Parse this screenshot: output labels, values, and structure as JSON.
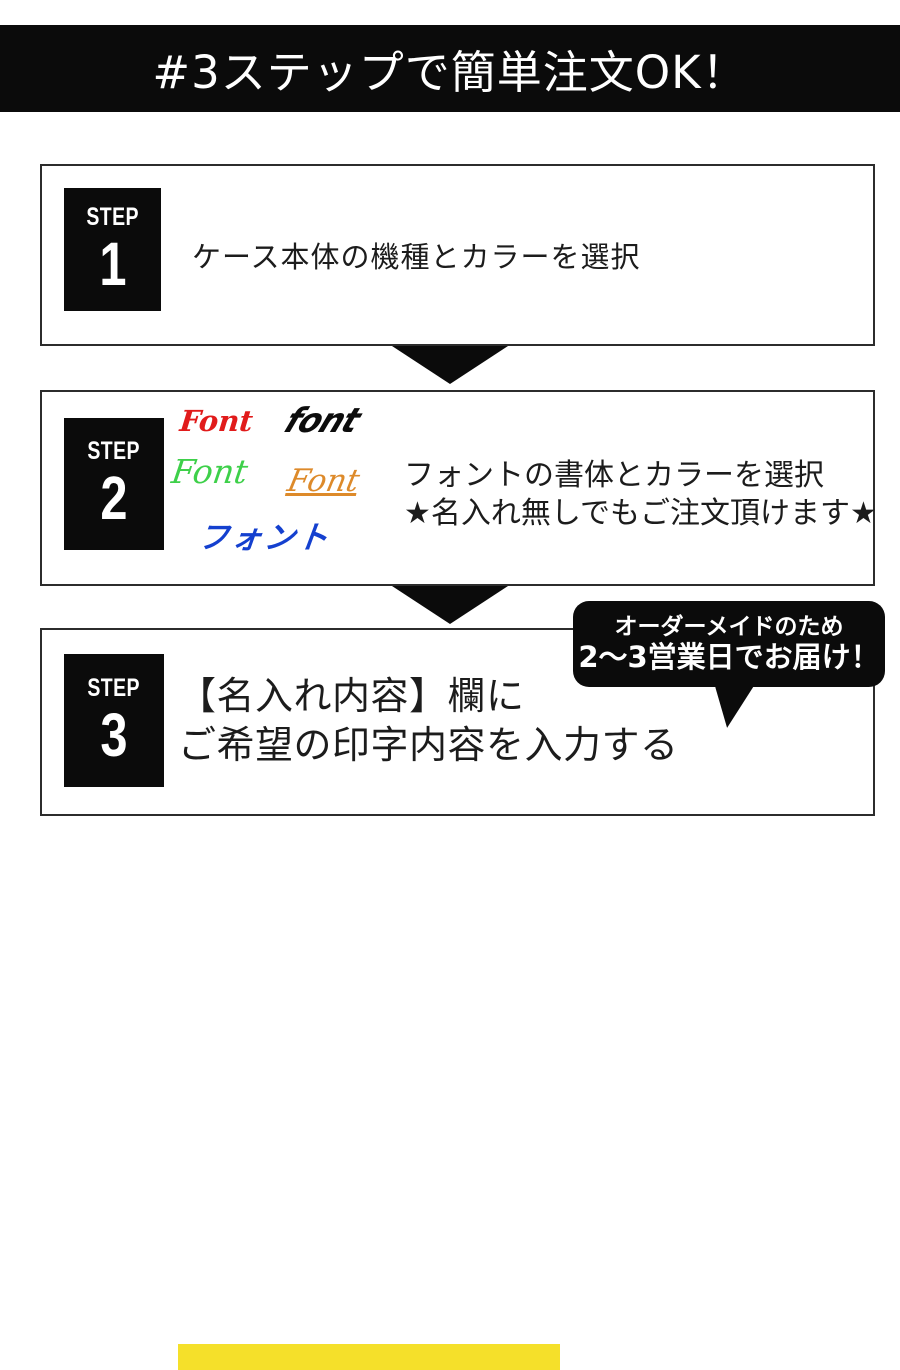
{
  "header": {
    "title": "#3ステップで簡単注文OK！",
    "background_color": "#0b0b0b",
    "text_color": "#ffffff"
  },
  "steps": [
    {
      "badge_word": "STEP",
      "badge_number": "1",
      "text": "ケース本体の機種とカラーを選択"
    },
    {
      "badge_word": "STEP",
      "badge_number": "2",
      "line1": "フォントの書体とカラーを選択",
      "line2": "★名入れ無しでもご注文頂けます★"
    },
    {
      "badge_word": "STEP",
      "badge_number": "3",
      "line1": "【名入れ内容】欄に",
      "line2": "ご希望の印字内容を入力する",
      "highlight_color": "#f5e02a"
    }
  ],
  "font_samples": [
    {
      "label": "Font",
      "color": "#e11b1b",
      "style": "bold-serif-italic"
    },
    {
      "label": "font",
      "color": "#0c0c0c",
      "style": "heavy-oblique-block"
    },
    {
      "label": "Font",
      "color": "#3ed04a",
      "style": "green-script"
    },
    {
      "label": "Font",
      "color": "#dd8a2a",
      "style": "orange-script-underline"
    },
    {
      "label": "フォント",
      "color": "#1440cf",
      "style": "blue-brush"
    }
  ],
  "speech_bubble": {
    "line1": "オーダーメイドのため",
    "line2": "2〜3営業日でお届け！",
    "background_color": "#0b0b0b",
    "text_color": "#ffffff"
  },
  "arrows": {
    "color": "#0b0b0b",
    "direction": "down"
  }
}
